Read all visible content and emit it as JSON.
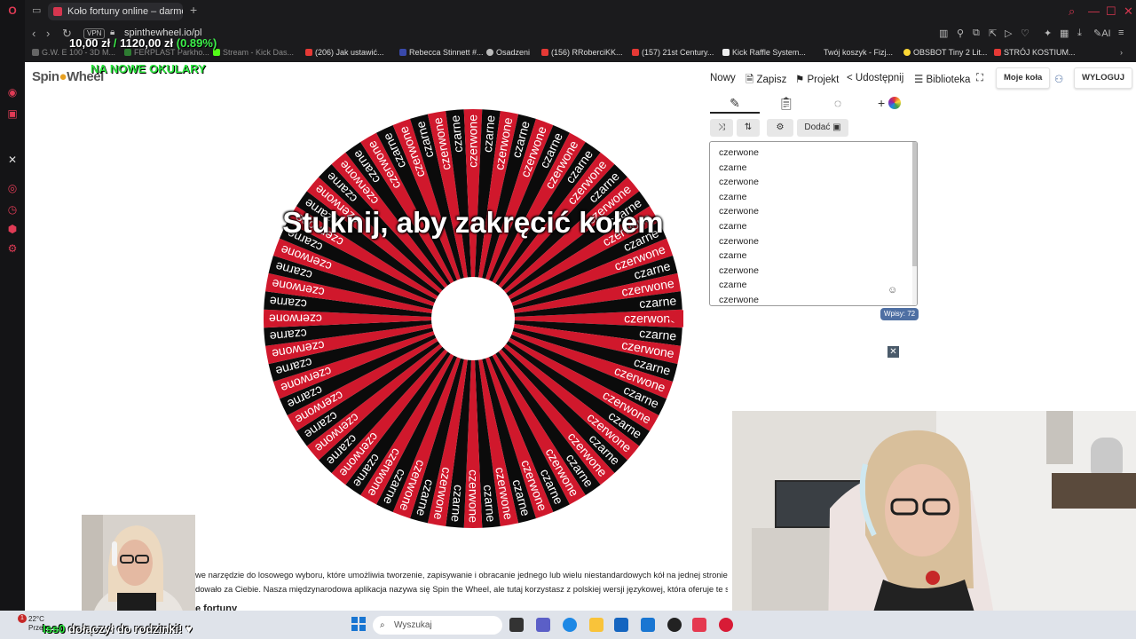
{
  "browser": {
    "tab_title": "Koło fortuny online – darmo",
    "new_tab": "+",
    "vpn_label": "VPN",
    "url": "spinthewheel.io/pl",
    "bookmarks": [
      "G.W. E 100 - 3D M...",
      "FERPLAST Parkho...",
      "Stream - Kick Das...",
      "(206) Jak ustawić...",
      "Rebecca Stinnett #...",
      "Osadzeni",
      "(156) RRoberciKK...",
      "(157) 21st Century...",
      "Kick Raffle System...",
      "Twój koszyk - Fizj...",
      "OBSBOT Tiny 2 Lit...",
      "STRÓJ KOSTIUM..."
    ]
  },
  "overlay": {
    "ticker_amount": "10,00 zł",
    "ticker_sep": "/",
    "ticker_total": "1120,00 zł",
    "ticker_pct": "(0.89%)",
    "promo": "NA NOWE OKULARY",
    "chat_name": "Iss0",
    "chat_text": "dołączył do rodzinki! ♥"
  },
  "site": {
    "logo_left": "Spin",
    "logo_right": "Wheel",
    "toolbar": {
      "new": "Nowy",
      "save": "Zapisz",
      "project": "Projekt",
      "share": "Udostępnij",
      "library": "Biblioteka",
      "my_wheels": "Moje koła",
      "logout": "WYLOGUJ"
    },
    "add_button": "Dodać",
    "tap_to_spin": "Stuknij, aby zakręcić kołem",
    "visible_entries": [
      "czerwone",
      "czarne",
      "czerwone",
      "czarne",
      "czerwone",
      "czarne",
      "czerwone",
      "czarne",
      "czerwone",
      "czarne",
      "czerwone"
    ],
    "entries_count": "Wpisy: 72",
    "description_line1": "we narzędzie do losowego wyboru, które umożliwia tworzenie, zapisywanie i obracanie jednego lub wielu niestandardowych kół na jednej stronie. D",
    "description_line2": "dowało za Ciebie. Nasza międzynarodowa aplikacja nazywa się Spin the Wheel, ale tutaj korzystasz z polskiej wersji językowej, która oferuje te sam",
    "description_heading": "e fortuny"
  },
  "wheel": {
    "segments": 72,
    "labels": [
      "czerwone",
      "czarne"
    ],
    "colors": [
      "#d0182c",
      "#0b0b0b"
    ],
    "text_colors": [
      "#ffffff",
      "#ffffff"
    ],
    "pointer_color": "#d0182c"
  },
  "taskbar": {
    "weather_temp": "22°C",
    "weather_text": "Prze",
    "weather_badge": "1",
    "search_placeholder": "Wyszukaj"
  }
}
